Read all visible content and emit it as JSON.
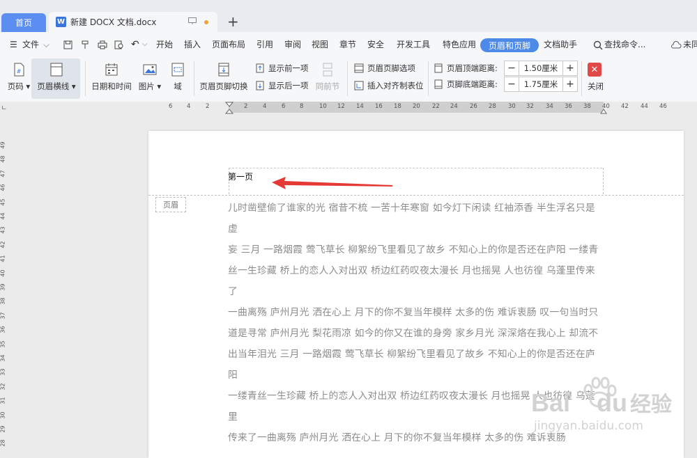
{
  "tabs": {
    "home": "首页",
    "doc_title": "新建 DOCX 文档.docx"
  },
  "menu": {
    "file": "文件",
    "items": [
      "开始",
      "插入",
      "页面布局",
      "引用",
      "审阅",
      "视图",
      "章节",
      "安全",
      "开发工具",
      "特色应用"
    ],
    "active": "页眉和页脚",
    "assistant": "文档助手",
    "search": "查找命令...",
    "unsynced": "未同"
  },
  "ribbon": {
    "page_number": "页码",
    "header_line": "页眉横线",
    "date_time": "日期和时间",
    "picture": "图片",
    "field": "域",
    "switch": "页眉页脚切换",
    "show_prev": "显示前一项",
    "show_next": "显示后一项",
    "same_prev": "同前节",
    "hf_options": "页眉页脚选项",
    "insert_tab": "插入对齐制表位",
    "header_top_label": "页眉顶端距离:",
    "header_top_value": "1.50厘米",
    "footer_bottom_label": "页脚底端距离:",
    "footer_bottom_value": "1.75厘米",
    "close": "关闭"
  },
  "ruler": {
    "h_ticks": [
      "6",
      "4",
      "2",
      "2",
      "4",
      "6",
      "8",
      "10",
      "12",
      "14",
      "16",
      "18",
      "20",
      "22",
      "24",
      "26",
      "28",
      "30",
      "32",
      "34",
      "36",
      "38",
      "40",
      "42",
      "44",
      "46"
    ],
    "v_ticks": [
      "49",
      "48",
      "47",
      "46",
      "45",
      "44",
      "43",
      "42",
      "41",
      "40",
      "39",
      "38",
      "37",
      "36",
      "35",
      "34",
      "33",
      "32",
      "31",
      "30",
      "29",
      "28"
    ]
  },
  "page": {
    "header_text": "第一页",
    "header_tag": "页眉",
    "body": [
      "儿时凿壁偷了谁家的光 宿昔不梳 一苦十年寒窗 如今灯下闲读 红袖添香 半生浮名只是虚",
      "妄 三月 一路烟霞 莺飞草长 柳絮纷飞里看见了故乡 不知心上的你是否还在庐阳 一缕青",
      "丝一生珍藏 桥上的恋人入对出双 桥边红药叹夜太漫长 月也摇晃 人也彷徨 乌蓬里传来了",
      "一曲离殇 庐州月光 洒在心上 月下的你不复当年模样 太多的伤 难诉衷肠 叹一句当时只",
      "道是寻常 庐州月光 梨花雨凉 如今的你又在谁的身旁 家乡月光 深深烙在我心上 却流不",
      "出当年泪光 三月 一路烟霞 莺飞草长 柳絮纷飞里看见了故乡 不知心上的你是否还在庐阳",
      "一缕青丝一生珍藏 桥上的恋人入对出双 桥边红药叹夜太漫长 月也摇晃 人也彷徨 乌蓬里",
      "传来了一曲离殇 庐州月光 洒在心上 月下的你不复当年模样 太多的伤 难诉衷肠"
    ]
  },
  "watermark": {
    "brand": "Bai",
    "brand2": "du",
    "cn": "经验",
    "url": "jingyan.baidu.com"
  },
  "colors": {
    "accent": "#4d8ae8",
    "home_tab": "#5b8ef0",
    "close": "#e14848",
    "arrow": "#e53935"
  }
}
